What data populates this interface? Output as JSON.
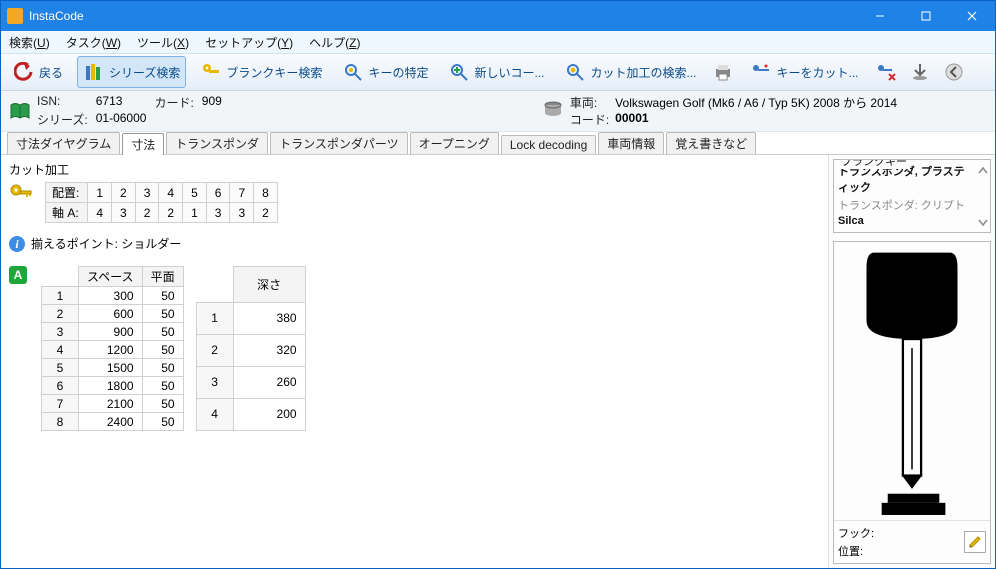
{
  "app": {
    "title": "InstaCode"
  },
  "window": {
    "min": "−",
    "max": "▢",
    "close": "✕"
  },
  "menu": {
    "search": {
      "text": "検索",
      "mnemonic": "U"
    },
    "task": {
      "text": "タスク",
      "mnemonic": "W"
    },
    "tool": {
      "text": "ツール",
      "mnemonic": "X"
    },
    "setup": {
      "text": "セットアップ",
      "mnemonic": "Y"
    },
    "help": {
      "text": "ヘルプ",
      "mnemonic": "Z"
    }
  },
  "toolbar": {
    "back": "戻る",
    "series_search": "シリーズ検索",
    "blank_search": "ブランクキー検索",
    "key_identify": "キーの特定",
    "new_code": "新しいコー...",
    "cut_search": "カット加工の検索...",
    "key_cut": "キーをカット..."
  },
  "info": {
    "isn_label": "ISN:",
    "isn_value": "6713",
    "card_label": "カード:",
    "card_value": "909",
    "series_label": "シリーズ:",
    "series_value": "01-06000",
    "vehicle_label": "車両:",
    "vehicle_value": "Volkswagen Golf (Mk6 / A6 / Typ 5K) 2008 から 2014",
    "code_label": "コード:",
    "code_value": "00001"
  },
  "tabs": {
    "diagram": "寸法ダイヤグラム",
    "dim": "寸法",
    "transponder": "トランスポンダ",
    "transponder_parts": "トランスポンダパーツ",
    "opening": "オープニング",
    "lock_decoding": "Lock decoding",
    "vehicle_info": "車両情報",
    "memo": "覚え書きなど"
  },
  "main": {
    "section_title": "カット加工",
    "layout_label": "配置:",
    "axis_label": "軸 A:",
    "positions": [
      "1",
      "2",
      "3",
      "4",
      "5",
      "6",
      "7",
      "8"
    ],
    "axis_values": [
      "4",
      "3",
      "2",
      "2",
      "1",
      "3",
      "3",
      "2"
    ],
    "align_point_label": "揃えるポイント:",
    "align_point_value": "ショルダー"
  },
  "space_table": {
    "hdr_space": "スペース",
    "hdr_plane": "平面",
    "rows": [
      {
        "i": "1",
        "space": "300",
        "plane": "50"
      },
      {
        "i": "2",
        "space": "600",
        "plane": "50"
      },
      {
        "i": "3",
        "space": "900",
        "plane": "50"
      },
      {
        "i": "4",
        "space": "1200",
        "plane": "50"
      },
      {
        "i": "5",
        "space": "1500",
        "plane": "50"
      },
      {
        "i": "6",
        "space": "1800",
        "plane": "50"
      },
      {
        "i": "7",
        "space": "2100",
        "plane": "50"
      },
      {
        "i": "8",
        "space": "2400",
        "plane": "50"
      }
    ]
  },
  "depth_table": {
    "hdr_depth": "深さ",
    "rows": [
      {
        "i": "1",
        "depth": "380"
      },
      {
        "i": "2",
        "depth": "320"
      },
      {
        "i": "3",
        "depth": "260"
      },
      {
        "i": "4",
        "depth": "200"
      }
    ]
  },
  "blank_panel": {
    "title": "ブランクキー",
    "item1": "トランスポンダ, プラスティック",
    "item2": "トランスポンダ: クリプト",
    "item3": "Silca"
  },
  "props": {
    "hook_label": "フック:",
    "hook_value": "",
    "pos_label": "位置:",
    "pos_value": ""
  }
}
